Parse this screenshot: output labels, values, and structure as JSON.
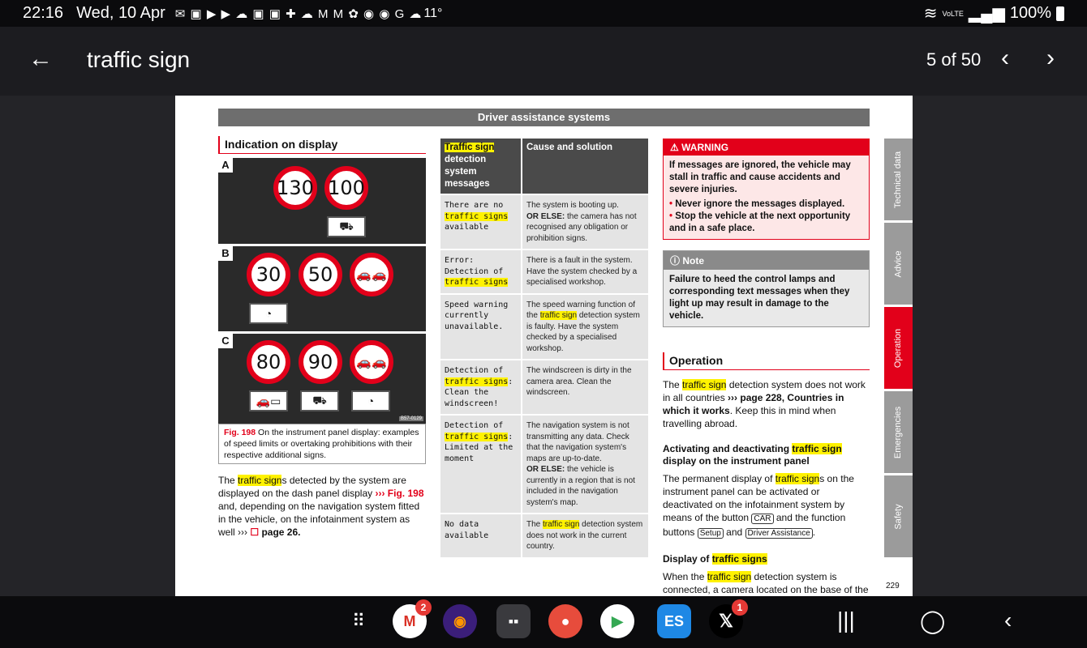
{
  "status": {
    "time": "22:16",
    "date": "Wed, 10 Apr",
    "temp": "11°",
    "battery": "100%",
    "network": "VoLTE"
  },
  "app": {
    "title": "traffic sign",
    "counter": "5 of 50"
  },
  "page": {
    "header": "Driver assistance systems",
    "page_number": "229",
    "tabs": [
      "Technical data",
      "Advice",
      "Operation",
      "Emergencies",
      "Safety"
    ],
    "section1": {
      "title": "Indication on display",
      "rows": [
        {
          "label": "A",
          "signs": [
            "130",
            "100"
          ]
        },
        {
          "label": "B",
          "signs": [
            "30",
            "50"
          ]
        },
        {
          "label": "C",
          "signs": [
            "80",
            "90"
          ]
        }
      ],
      "image_code": "B57-0129",
      "caption_fig": "Fig. 198",
      "caption_text": "On the instrument panel display: examples of speed limits or overtaking prohibitions with their respective additional signs.",
      "body_a": "The ",
      "body_hl": "traffic sign",
      "body_b": "s detected by the system are displayed on the dash panel display ",
      "body_ref": "››› Fig. 198",
      "body_c": " and, depending on the navigation system fitted in the vehicle, on the infotainment system as well ››› ",
      "body_page": "page 26."
    },
    "table": {
      "h1_hl": "Traffic sign",
      "h1_rest": " detection system messages",
      "h2": "Cause and solution",
      "rows": [
        {
          "m1": "There are no ",
          "mhl": "traffic signs",
          "m2": " available",
          "s1": "The system is booting up.",
          "s2b": "OR ELSE:",
          "s2": " the camera has not recognised any obligation or prohibition signs."
        },
        {
          "m1": "Error: Detection of ",
          "mhl": "traffic signs",
          "m2": "",
          "s1": "There is a fault in the system. Have the system checked by a specialised workshop.",
          "s2b": "",
          "s2": ""
        },
        {
          "m1": "Speed warning currently unavailable.",
          "mhl": "",
          "m2": "",
          "s1": "The speed warning function of the ",
          "s1hl": "traffic sign",
          "s1b": " detection system is faulty. Have the system checked by a specialised workshop.",
          "s2b": "",
          "s2": ""
        },
        {
          "m1": "Detection of ",
          "mhl": "traffic signs",
          "m2": ": Clean the windscreen!",
          "s1": "The windscreen is dirty in the camera area. Clean the windscreen.",
          "s2b": "",
          "s2": ""
        },
        {
          "m1": "Detection of ",
          "mhl": "traffic signs",
          "m2": ": Limited at the moment",
          "s1": "The navigation system is not transmitting any data. Check that the navigation system's maps are up-to-date.",
          "s2b": "OR ELSE:",
          "s2": " the vehicle is currently in a region that is not included in the navigation system's map."
        },
        {
          "m1": "No data available",
          "mhl": "",
          "m2": "",
          "s1": "The ",
          "s1hl": "traffic sign",
          "s1b": " detection system does not work in the current country.",
          "s2b": "",
          "s2": ""
        }
      ]
    },
    "warning": {
      "title": "WARNING",
      "lead": "If messages are ignored, the vehicle may stall in traffic and cause accidents and severe injuries.",
      "items": [
        "Never ignore the messages displayed.",
        "Stop the vehicle at the next opportunity and in a safe place."
      ]
    },
    "note": {
      "title": "Note",
      "text": "Failure to heed the control lamps and corresponding text messages when they light up may result in damage to the vehicle."
    },
    "operation": {
      "title": "Operation",
      "p1a": "The ",
      "p1hl": "traffic sign",
      "p1b": " detection system does not work in all countries ",
      "p1ref": "››› page 228, Countries in which it works",
      "p1c": ". Keep this in mind when travelling abroad.",
      "h1a": "Activating and deactivating ",
      "h1hl": "traffic sign",
      "h1b": " display on the instrument panel",
      "p2a": "The permanent display of ",
      "p2hl": "traffic sign",
      "p2b": "s on the instrument panel can be activated or deactivated on the infotainment system by means of the button ",
      "btn_car": "CAR",
      "p2c": " and the function buttons ",
      "btn_setup": "Setup",
      "p2d": " and ",
      "btn_da": "Driver Assistance",
      "p2e": ".",
      "h2a": "Display of ",
      "h2hl": "traffic signs",
      "p3a": "When the ",
      "p3hl": "traffic sign",
      "p3b": " detection system is connected, a camera located on the base of the",
      "cont": "»"
    }
  },
  "dock": {
    "gmail_badge": "2",
    "x_badge": "1"
  }
}
